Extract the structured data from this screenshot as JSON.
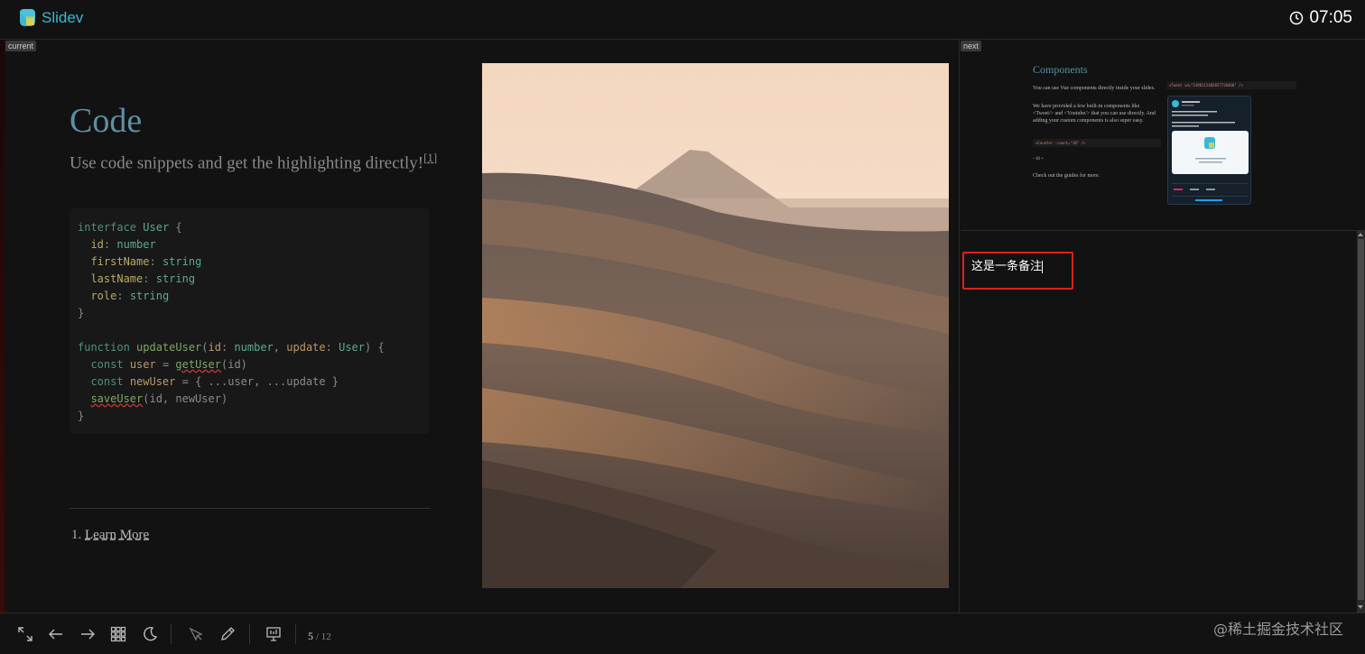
{
  "app": {
    "name": "Slidev",
    "accent": "#3ab9d5"
  },
  "clock": {
    "time": "07:05",
    "icon": "clock-icon"
  },
  "current": {
    "tag": "current",
    "slide": {
      "title": "Code",
      "subtitle": "Use code snippets and get the highlighting directly!",
      "footnote_ref": "[1]",
      "code_lines": [
        "interface User {",
        "  id: number",
        "  firstName: string",
        "  lastName: string",
        "  role: string",
        "}",
        "",
        "function updateUser(id: number, update: User) {",
        "  const user = getUser(id)",
        "  const newUser = { ...user, ...update }",
        "  saveUser(id, newUser)",
        "}"
      ],
      "footnote_number": "1.",
      "footnote_link": "Learn More"
    }
  },
  "next": {
    "tag": "next",
    "slide": {
      "title": "Components",
      "p1": "You can use Vue components directly inside your slides.",
      "p2": "We have provided a few built-in components like <Tweet/> and <Youtube/> that you can use directly. And adding your custom components is also super easy.",
      "code1": "<Counter :count=\"10\" />",
      "counter": "-  10  +",
      "p3": "Check out the guides for more.",
      "code2": "<Tweet id=\"1390115482657726468\" />"
    }
  },
  "notes": {
    "text": "这是一条备注"
  },
  "toolbar": {
    "buttons": [
      "fullscreen-icon",
      "arrow-left-icon",
      "arrow-right-icon",
      "grid-icon",
      "moon-icon",
      "cursor-icon",
      "pen-icon",
      "presenter-icon"
    ],
    "page_current": "5",
    "page_total": "/ 12"
  },
  "watermark": "@稀土掘金技术社区"
}
